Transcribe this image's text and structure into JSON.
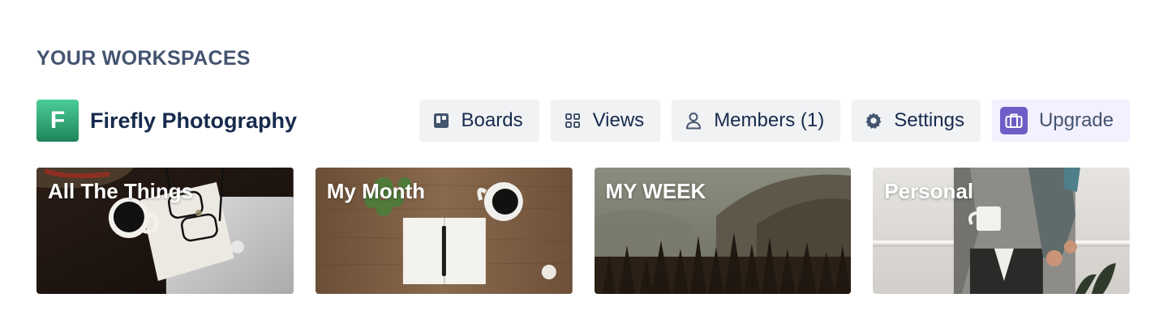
{
  "section": {
    "title": "YOUR WORKSPACES"
  },
  "workspace": {
    "avatar_letter": "F",
    "name": "Firefly Photography",
    "actions": [
      {
        "label": "Boards",
        "icon": "board-icon"
      },
      {
        "label": "Views",
        "icon": "grid-icon"
      },
      {
        "label": "Members (1)",
        "icon": "person-icon"
      },
      {
        "label": "Settings",
        "icon": "gear-icon"
      },
      {
        "label": "Upgrade",
        "icon": "briefcase-icon"
      }
    ]
  },
  "boards": [
    {
      "title": "All The Things"
    },
    {
      "title": "My Month"
    },
    {
      "title": "MY WEEK"
    },
    {
      "title": "Personal"
    }
  ],
  "colors": {
    "avatar_top": "#4bce97",
    "avatar_bottom": "#1f845a",
    "button_bg": "#f1f2f4",
    "upgrade_bg": "#f3f0ff",
    "upgrade_icon_bg": "#6e5dc6",
    "section_title": "#44546f",
    "text_primary": "#172b4d"
  }
}
